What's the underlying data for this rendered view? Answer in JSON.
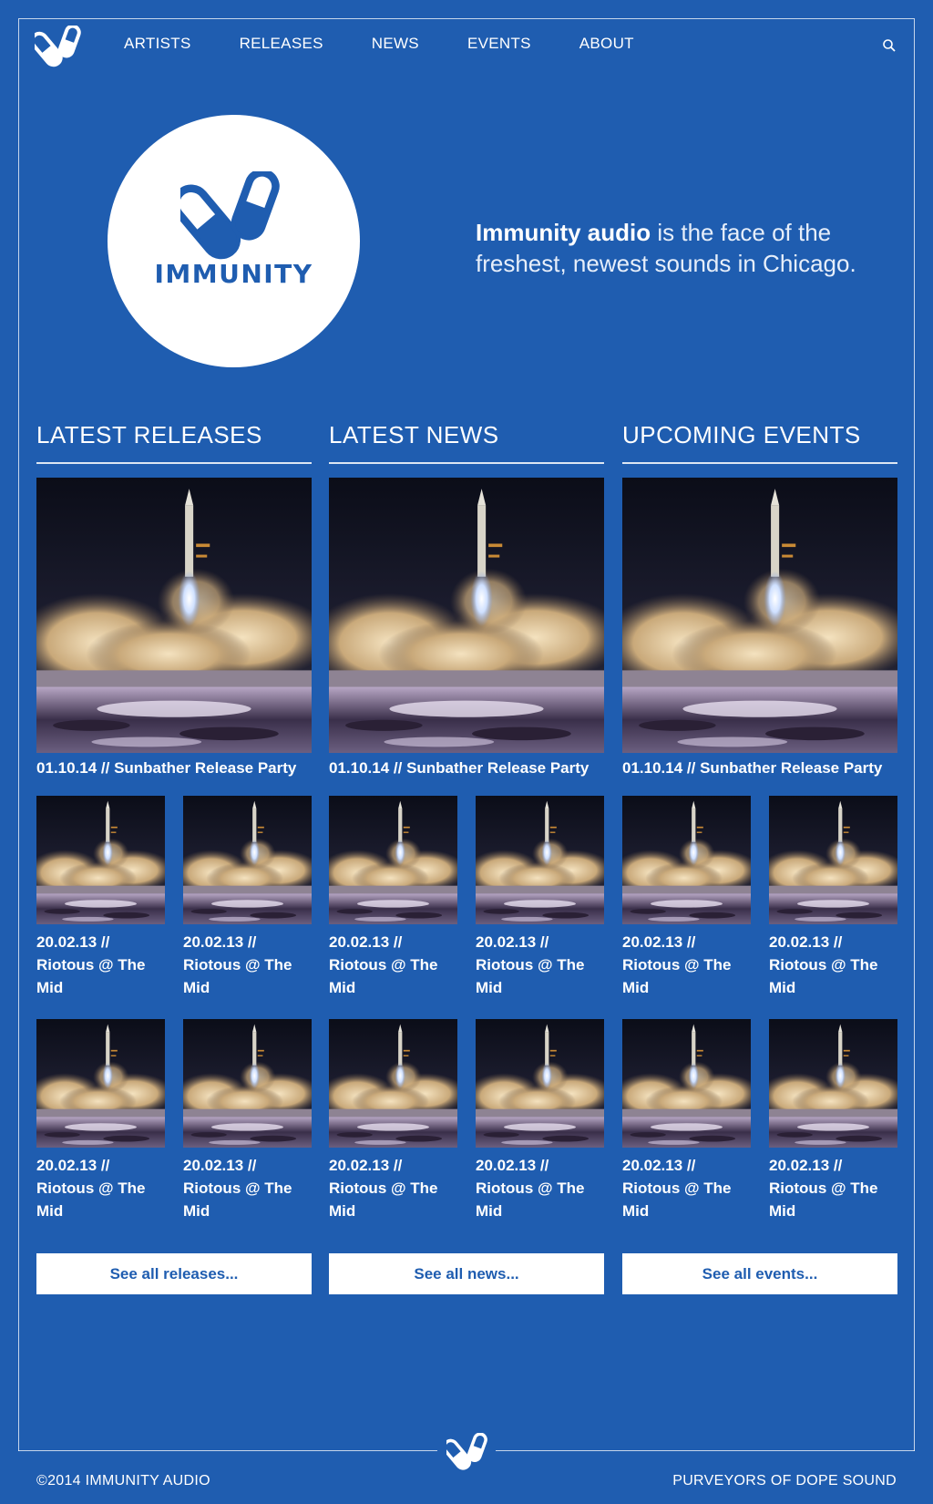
{
  "nav": {
    "items": [
      "ARTISTS",
      "RELEASES",
      "NEWS",
      "EVENTS",
      "ABOUT"
    ],
    "logo_icon": "pills-logo-icon",
    "search_icon": "search-icon"
  },
  "hero": {
    "logo_text": "IMMUNITY",
    "tagline_bold": "Immunity audio",
    "tagline_rest": " is the face of the freshest, newest sounds in Chicago."
  },
  "columns": [
    {
      "title": "LATEST RELEASES",
      "feature_caption": "01.10.14 // Sunbather Release Party",
      "thumb_captions": [
        "20.02.13 // Riotous @ The Mid",
        "20.02.13 // Riotous @ The Mid",
        "20.02.13 // Riotous @ The Mid",
        "20.02.13 // Riotous @ The Mid"
      ],
      "see_all": "See all releases..."
    },
    {
      "title": "LATEST NEWS",
      "feature_caption": "01.10.14 // Sunbather Release Party",
      "thumb_captions": [
        "20.02.13 // Riotous @ The Mid",
        "20.02.13 // Riotous @ The Mid",
        "20.02.13 // Riotous @ The Mid",
        "20.02.13 // Riotous @ The Mid"
      ],
      "see_all": "See all news..."
    },
    {
      "title": "UPCOMING EVENTS",
      "feature_caption": "01.10.14 // Sunbather Release Party",
      "thumb_captions": [
        "20.02.13 // Riotous @ The Mid",
        "20.02.13 // Riotous @ The Mid",
        "20.02.13 // Riotous @ The Mid",
        "20.02.13 // Riotous @ The Mid"
      ],
      "see_all": "See all events..."
    }
  ],
  "footer": {
    "copyright": "©2014 IMMUNITY AUDIO",
    "slogan": "PURVEYORS OF DOPE SOUND"
  },
  "colors": {
    "background": "#1f5db0",
    "text": "#ffffff",
    "button_bg": "#ffffff",
    "button_text": "#1f5db0"
  }
}
